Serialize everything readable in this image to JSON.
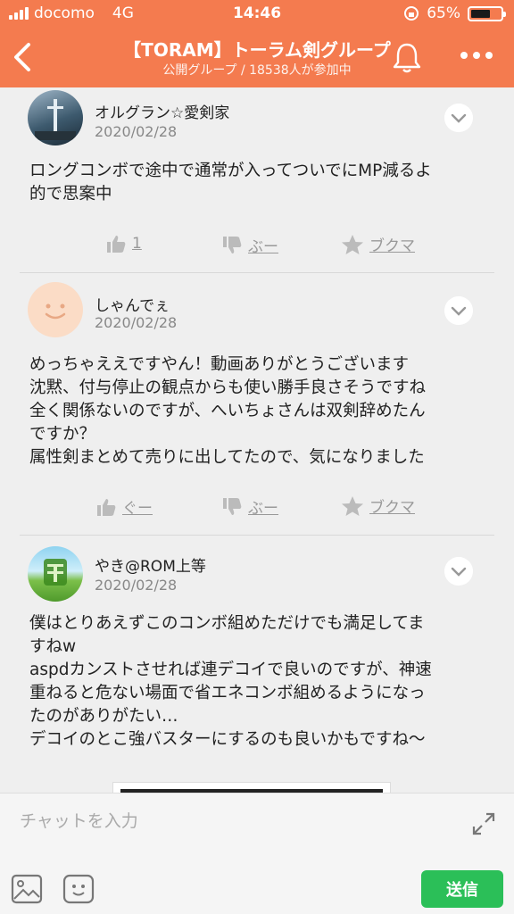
{
  "status_bar": {
    "carrier": "docomo",
    "network": "4G",
    "time": "14:46",
    "battery": "65%",
    "battery_level": 0.65
  },
  "header": {
    "title": "【TORAM】トーラム剣グループ",
    "subtitle": "公開グループ / 18538人が参加中",
    "icons": [
      "back-icon",
      "bell-icon",
      "more-icon"
    ]
  },
  "posts": [
    {
      "user": "オルグラン☆愛剣家",
      "date": "2020/02/28",
      "lines": [
        "ロングコンボで途中で通常が入ってついでにMP減るよ",
        "的で思案中"
      ],
      "like": "1",
      "dislike": "ぶー",
      "bookmark": "ブクマ"
    },
    {
      "user": "しゃんでぇ",
      "date": "2020/02/28",
      "lines": [
        "めっちゃええですやん！動画ありがとうございます",
        "沈黙、付与停止の観点からも使い勝手良さそうですね",
        "全く関係ないのですが、へいちょさんは双剣辞めたん",
        "ですか？",
        "属性剣まとめて売りに出してたので、気になりました"
      ],
      "like": "ぐー",
      "dislike": "ぶー",
      "bookmark": "ブクマ"
    },
    {
      "user": "やき@ROM上等",
      "date": "2020/02/28",
      "lines": [
        "僕はとりあえずこのコンボ組めただけでも満足してま",
        "すねw",
        "aspdカンストさせれば連デコイで良いのですが、神速",
        "重ねると危ない場面で省エネコンボ組めるようになっ",
        "たのがありがたい…",
        "デコイのとこ強バスターにするのも良いかもですね〜"
      ]
    }
  ],
  "input": {
    "placeholder": "チャットを入力",
    "send_label": "送信"
  },
  "colors": {
    "header": "#f47b4f",
    "send": "#2bbf58"
  }
}
